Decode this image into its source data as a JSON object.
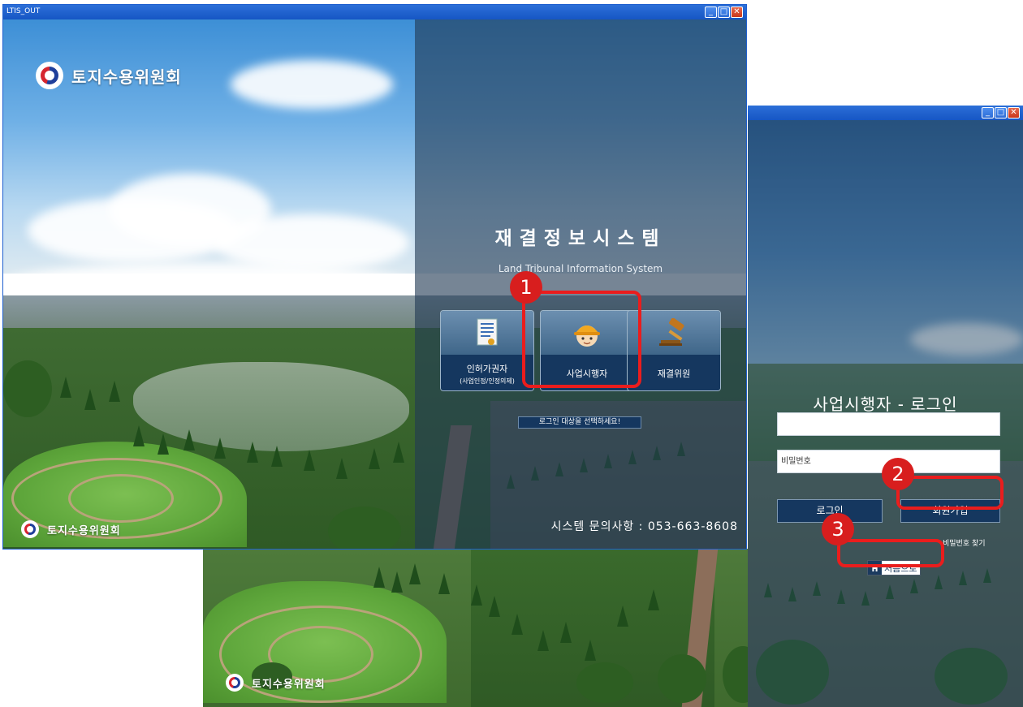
{
  "window_main": {
    "title": "LTIS_OUT",
    "brand_name": "토지수용위원회",
    "system_title": "재결정보시스템",
    "system_subtitle": "Land Tribunal Information System",
    "roles": [
      {
        "label": "인허가권자",
        "sub": "(사업인정/인정의제)",
        "icon": "certificate-icon"
      },
      {
        "label": "사업시행자",
        "sub": "",
        "icon": "hardhat-worker-icon"
      },
      {
        "label": "재결위원",
        "sub": "",
        "icon": "gavel-icon"
      }
    ],
    "select_prompt": "로그인 대상을 선택하세요!",
    "contact": "시스템 문의사항 : 053-663-8608"
  },
  "window_login": {
    "title": "사업시행자 - 로그인",
    "id_value": "",
    "password_placeholder": "비밀번호",
    "login_button": "로그인",
    "signup_button": "회원가입",
    "find_password_link": "비밀번호 찾기",
    "home_button": "처음으로"
  },
  "window_back": {
    "brand_name": "토지수용위원회"
  },
  "window_controls": {
    "minimize": "_",
    "maximize": "□",
    "close": "✕"
  },
  "annotations": [
    "1",
    "2",
    "3"
  ],
  "colors": {
    "annotation": "#EA1D1D",
    "button_navy": "#15375F",
    "titlebar": "#1656C4"
  }
}
